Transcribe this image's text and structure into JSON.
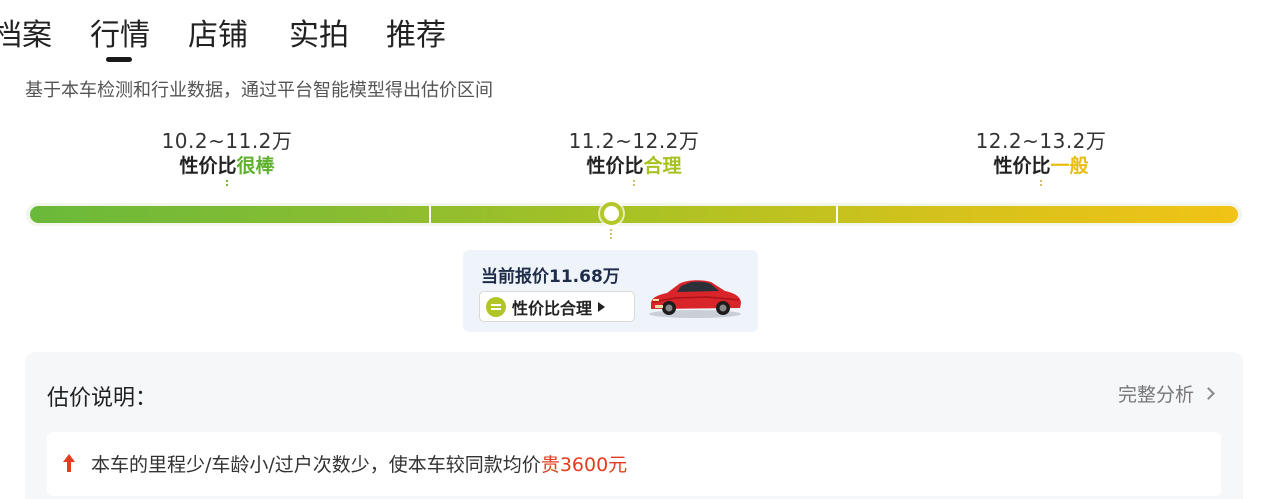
{
  "tabs": [
    {
      "label": "档案"
    },
    {
      "label": "行情",
      "active": true
    },
    {
      "label": "店铺"
    },
    {
      "label": "实拍"
    },
    {
      "label": "推荐"
    }
  ],
  "subtitle": "基于本车检测和行业数据，通过平台智能模型得出估价区间",
  "ranges": [
    {
      "price": "10.2~11.2万",
      "rating_prefix": "性价比",
      "rating_level": "很棒",
      "level_color": "#5fb12e"
    },
    {
      "price": "11.2~12.2万",
      "rating_prefix": "性价比",
      "rating_level": "合理",
      "level_color": "#a8c21f"
    },
    {
      "price": "12.2~13.2万",
      "rating_prefix": "性价比",
      "rating_level": "一般",
      "level_color": "#e8be14"
    }
  ],
  "price_bar": {
    "min": 10.2,
    "max": 13.2,
    "current_value": 11.68,
    "colors": [
      "#6ab93a",
      "#a9c224",
      "#f1c316"
    ]
  },
  "current_quote": {
    "label": "当前报价11.68万",
    "badge": "性价比合理",
    "badge_color": "#b2c526",
    "car_image": "red-sedan-image"
  },
  "explanation": {
    "title": "估价说明：",
    "link_label": "完整分析",
    "note_icon": "arrow-up-icon",
    "note_text": "本车的里程少/车龄小/过户次数少，使本车较同款均价",
    "note_highlight": "贵3600元",
    "highlight_color": "#e33d1f"
  }
}
